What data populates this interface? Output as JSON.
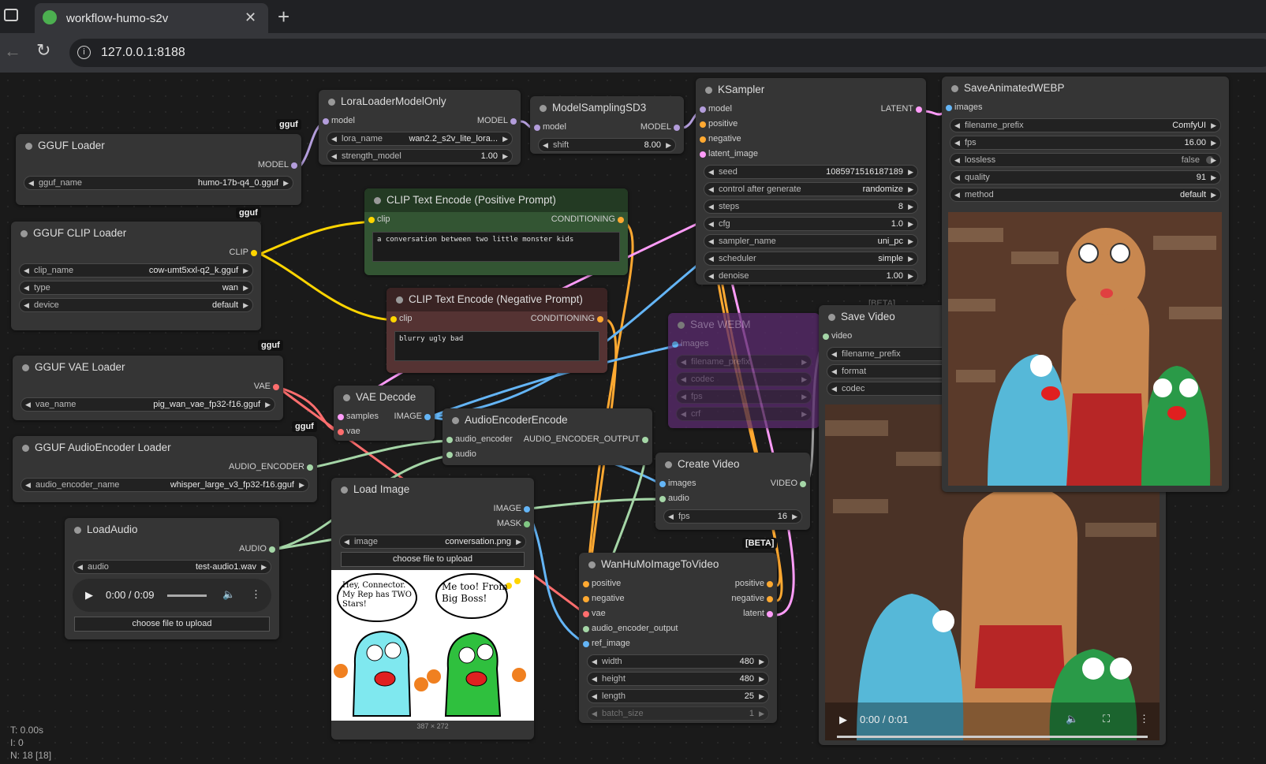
{
  "browser": {
    "tab_title": "workflow-humo-s2v",
    "url": "127.0.0.1:8188",
    "new_tab": "+",
    "tab_close": "✕"
  },
  "nodes": {
    "gguf_loader": {
      "title": "GGUF Loader",
      "output": "MODEL",
      "widget_label": "gguf_name",
      "widget_value": "humo-17b-q4_0.gguf",
      "tag": "gguf"
    },
    "lora": {
      "title": "LoraLoaderModelOnly",
      "input": "model",
      "output": "MODEL",
      "w1_label": "lora_name",
      "w1_value": "wan2.2_s2v_lite_lora...",
      "w2_label": "strength_model",
      "w2_value": "1.00"
    },
    "msd3": {
      "title": "ModelSamplingSD3",
      "input": "model",
      "output": "MODEL",
      "w_label": "shift",
      "w_value": "8.00"
    },
    "ksampler": {
      "title": "KSampler",
      "inputs": [
        "model",
        "positive",
        "negative",
        "latent_image"
      ],
      "output": "LATENT",
      "widgets": [
        {
          "label": "seed",
          "value": "1085971516187189"
        },
        {
          "label": "control after generate",
          "value": "randomize"
        },
        {
          "label": "steps",
          "value": "8"
        },
        {
          "label": "cfg",
          "value": "1.0"
        },
        {
          "label": "sampler_name",
          "value": "uni_pc"
        },
        {
          "label": "scheduler",
          "value": "simple"
        },
        {
          "label": "denoise",
          "value": "1.00"
        }
      ]
    },
    "save_webp": {
      "title": "SaveAnimatedWEBP",
      "input": "images",
      "widgets": [
        {
          "label": "filename_prefix",
          "value": "ComfyUI"
        },
        {
          "label": "fps",
          "value": "16.00"
        },
        {
          "label": "lossless",
          "value": "false"
        },
        {
          "label": "quality",
          "value": "91"
        },
        {
          "label": "method",
          "value": "default"
        }
      ]
    },
    "clip_loader": {
      "title": "GGUF CLIP Loader",
      "output": "CLIP",
      "tag": "gguf",
      "widgets": [
        {
          "label": "clip_name",
          "value": "cow-umt5xxl-q2_k.gguf"
        },
        {
          "label": "type",
          "value": "wan"
        },
        {
          "label": "device",
          "value": "default"
        }
      ]
    },
    "clip_pos": {
      "title": "CLIP Text Encode (Positive Prompt)",
      "input": "clip",
      "output": "CONDITIONING",
      "text": "a conversation between two little monster kids"
    },
    "clip_neg": {
      "title": "CLIP Text Encode (Negative Prompt)",
      "input": "clip",
      "output": "CONDITIONING",
      "text": "blurry ugly bad"
    },
    "vae_loader": {
      "title": "GGUF VAE Loader",
      "output": "VAE",
      "tag": "gguf",
      "widget_label": "vae_name",
      "widget_value": "pig_wan_vae_fp32-f16.gguf"
    },
    "vae_decode": {
      "title": "VAE Decode",
      "inputs": [
        "samples",
        "vae"
      ],
      "output": "IMAGE"
    },
    "save_webm": {
      "title": "Save WEBM",
      "beta": "[BETA]",
      "input": "images",
      "widgets": [
        "filename_prefix",
        "codec",
        "fps",
        "crf"
      ]
    },
    "save_video": {
      "title": "Save Video",
      "input": "video",
      "widgets": [
        "filename_prefix",
        "format",
        "codec"
      ],
      "time": "0:00 / 0:01"
    },
    "audio_loader": {
      "title": "GGUF AudioEncoder Loader",
      "output": "AUDIO_ENCODER",
      "tag": "gguf",
      "widget_label": "audio_encoder_name",
      "widget_value": "whisper_large_v3_fp32-f16.gguf"
    },
    "audio_enc": {
      "title": "AudioEncoderEncode",
      "inputs": [
        "audio_encoder",
        "audio"
      ],
      "output": "AUDIO_ENCODER_OUTPUT"
    },
    "load_image": {
      "title": "Load Image",
      "outputs": [
        "IMAGE",
        "MASK"
      ],
      "widget_label": "image",
      "widget_value": "conversation.png",
      "button": "choose file to upload",
      "dims": "387 × 272",
      "bubble1": "Hey, Connector. My Rep has TWO Stars!",
      "bubble2": "Me too! From Big Boss!"
    },
    "load_audio": {
      "title": "LoadAudio",
      "output": "AUDIO",
      "widget_label": "audio",
      "widget_value": "test-audio1.wav",
      "time": "0:00 / 0:09",
      "button": "choose file to upload"
    },
    "create_video": {
      "title": "Create Video",
      "inputs": [
        "images",
        "audio"
      ],
      "output": "VIDEO",
      "widget_label": "fps",
      "widget_value": "16"
    },
    "wanhumo": {
      "title": "WanHuMoImageToVideo",
      "beta": "[BETA]",
      "inputs": [
        "positive",
        "negative",
        "vae",
        "audio_encoder_output",
        "ref_image"
      ],
      "outputs": [
        "positive",
        "negative",
        "latent"
      ],
      "widgets": [
        {
          "label": "width",
          "value": "480"
        },
        {
          "label": "height",
          "value": "480"
        },
        {
          "label": "length",
          "value": "25"
        },
        {
          "label": "batch_size",
          "value": "1"
        }
      ]
    }
  },
  "stats": {
    "t": "T: 0.00s",
    "i": "I: 0",
    "n": "N: 18 [18]"
  },
  "colors": {
    "model": "#b39ddb",
    "clip": "#ffd500",
    "conditioning": "#ffa931",
    "vae": "#ff6e6e",
    "latent": "#ff9cf9",
    "image": "#64b5f6",
    "audio": "#a5d6a7",
    "mask": "#81c784"
  }
}
